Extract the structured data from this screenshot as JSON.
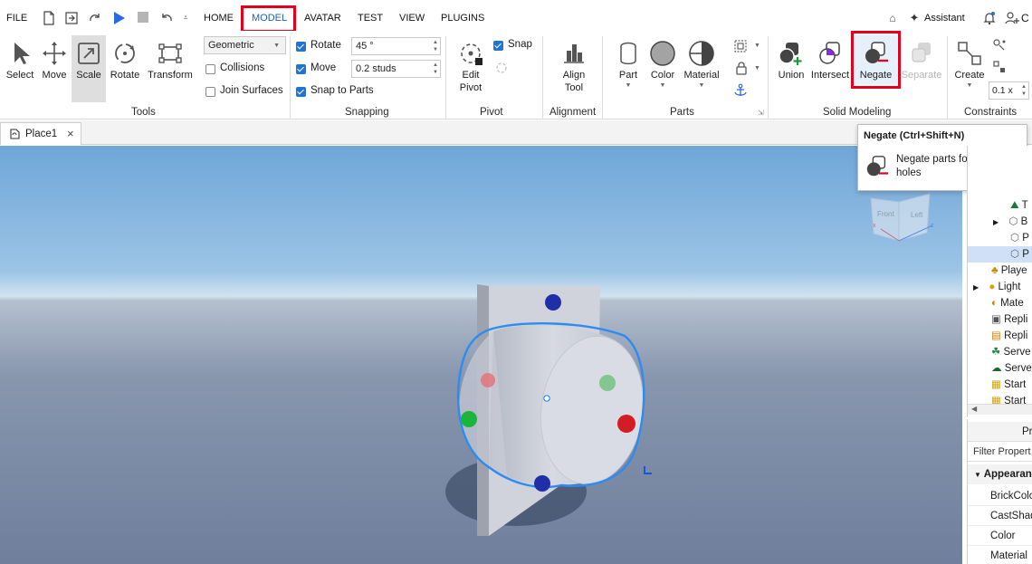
{
  "menu": {
    "file": "FILE",
    "tabs": [
      "HOME",
      "MODEL",
      "AVATAR",
      "TEST",
      "VIEW",
      "PLUGINS"
    ],
    "assistant": "Assistant",
    "collab_partial": "C"
  },
  "ribbon": {
    "tools": {
      "select": "Select",
      "move": "Move",
      "scale": "Scale",
      "rotate": "Rotate",
      "transform": "Transform",
      "group_label": "Tools",
      "mode_select": "Geometric",
      "collisions": "Collisions",
      "join_surfaces": "Join Surfaces"
    },
    "snapping": {
      "rotate_label": "Rotate",
      "rotate_value": "45 °",
      "move_label": "Move",
      "move_value": "0.2 studs",
      "snap_to_parts": "Snap to Parts",
      "group_label": "Snapping"
    },
    "pivot": {
      "edit_pivot_l1": "Edit",
      "edit_pivot_l2": "Pivot",
      "snap": "Snap",
      "group_label": "Pivot"
    },
    "alignment": {
      "align_l1": "Align",
      "align_l2": "Tool",
      "group_label": "Alignment"
    },
    "parts": {
      "part": "Part",
      "color": "Color",
      "material": "Material",
      "group_label": "Parts"
    },
    "solid_modeling": {
      "union": "Union",
      "intersect": "Intersect",
      "negate": "Negate",
      "separate": "Separate",
      "group_label": "Solid Modeling"
    },
    "constraints": {
      "create": "Create",
      "scale_value": "0.1 x",
      "group_label": "Constraints"
    }
  },
  "tooltip": {
    "title": "Negate (Ctrl+Shift+N)",
    "description": "Negate parts for making holes"
  },
  "doc_tab": {
    "label": "Place1"
  },
  "viewcube": {
    "left_face": "Left",
    "front_face": "Front"
  },
  "explorer": {
    "items": [
      "T",
      "B",
      "P",
      "P",
      "Playe",
      "Light",
      "Mate",
      "Repli",
      "Repli",
      "Serve",
      "Serve",
      "Start",
      "Start"
    ]
  },
  "properties": {
    "header": "Pr",
    "filter_placeholder": "Filter Propert",
    "section": "Appearan",
    "rows": [
      "BrickColo",
      "CastShad",
      "Color",
      "Material"
    ]
  },
  "colors": {
    "accent": "#1f74d4",
    "highlight_red": "#e3001b",
    "selected_bg": "#e6f0fb",
    "negate_red": "#c8102e"
  }
}
